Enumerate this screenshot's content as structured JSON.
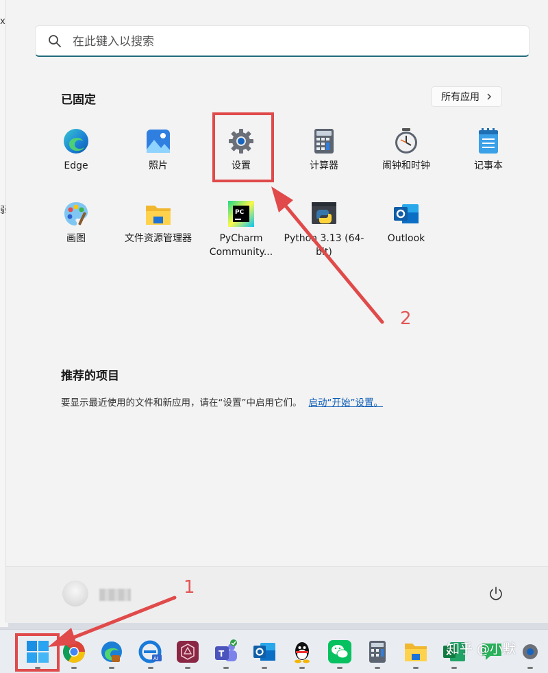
{
  "background": {
    "left_fragments": [
      "x",
      "弱"
    ]
  },
  "search": {
    "placeholder": "在此键入以搜索",
    "icon": "search-icon"
  },
  "pinned": {
    "title": "已固定",
    "all_apps_label": "所有应用",
    "all_apps_icon": "chevron-right-icon",
    "apps": [
      {
        "label": "Edge",
        "icon": "edge-icon"
      },
      {
        "label": "照片",
        "icon": "photos-icon"
      },
      {
        "label": "设置",
        "icon": "gear-icon"
      },
      {
        "label": "计算器",
        "icon": "calculator-icon"
      },
      {
        "label": "闹钟和时钟",
        "icon": "clock-icon"
      },
      {
        "label": "记事本",
        "icon": "notepad-icon"
      },
      {
        "label": "画图",
        "icon": "paint-palette-icon"
      },
      {
        "label": "文件资源管理器",
        "icon": "folder-icon"
      },
      {
        "label": "PyCharm Community...",
        "label_line1": "PyCharm",
        "label_line2": "Community...",
        "icon": "pycharm-icon"
      },
      {
        "label": "Python 3.13 (64-bit)",
        "label_line1": "Python 3.13 (64-",
        "label_line2": "bit)",
        "icon": "python-icon"
      },
      {
        "label": "Outlook",
        "icon": "outlook-icon"
      }
    ]
  },
  "recommended": {
    "title": "推荐的项目",
    "message": "要显示最近使用的文件和新应用，请在“设置”中启用它们。",
    "link": "启动“开始”设置。"
  },
  "footer": {
    "power_icon": "power-icon"
  },
  "annotations": {
    "step1": "1",
    "step2": "2",
    "color": "#e04a4a"
  },
  "taskbar": {
    "items": [
      "windows-start-icon",
      "chrome-icon",
      "edge-icon",
      "ie-edge-ai-icon",
      "app-hexagon-icon",
      "teams-icon",
      "outlook-icon",
      "qq-icon",
      "wechat-icon",
      "calculator-icon",
      "folder-icon",
      "excel-icon",
      "chat-icon",
      "settings-icon"
    ]
  },
  "watermark": "知乎 @小默"
}
